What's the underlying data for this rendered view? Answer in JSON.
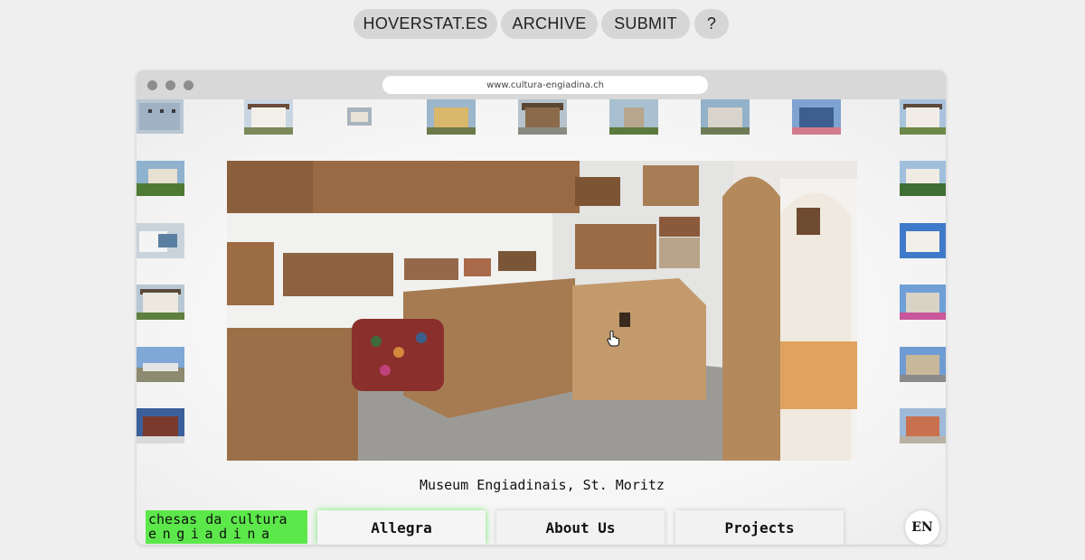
{
  "top_nav": {
    "site": "HOVERSTAT.ES",
    "archive": "ARCHIVE",
    "submit": "SUBMIT",
    "help": "?"
  },
  "browser": {
    "url": "www.cultura-engiadina.ch"
  },
  "hero": {
    "caption": "Museum Engiadinais, St. Moritz"
  },
  "logo": {
    "line1": "chesas da cultura",
    "line2": "engiadina"
  },
  "site_nav": {
    "items": [
      "Allegra",
      "About Us",
      "Projects"
    ],
    "active": "Allegra"
  },
  "language": "EN",
  "colors": {
    "accent_green": "#5ce84a",
    "background": "#efefef",
    "pill": "#d6d6d6"
  }
}
